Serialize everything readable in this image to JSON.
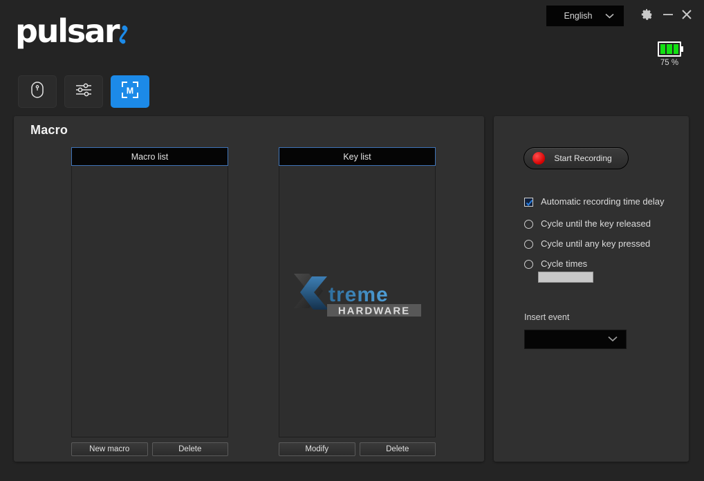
{
  "app": {
    "brand": "pulsar",
    "brand_mark_icon": "pulsar-comma-icon"
  },
  "header": {
    "language": {
      "value": "English",
      "chevron_icon": "chevron-down-icon"
    },
    "window_controls": {
      "settings_icon": "gear-icon",
      "minimize_icon": "minimize-icon",
      "close_icon": "close-icon"
    },
    "battery": {
      "label": "75 %",
      "bars": 3,
      "color": "#12e012",
      "icon": "battery-icon"
    }
  },
  "tabs": [
    {
      "name": "mouse",
      "icon": "mouse-icon",
      "active": false
    },
    {
      "name": "settings",
      "icon": "sliders-icon",
      "active": false
    },
    {
      "name": "macro",
      "icon": "macro-m-icon",
      "active": true
    }
  ],
  "main": {
    "title": "Macro",
    "macro_list": {
      "header": "Macro list",
      "items": [],
      "buttons": [
        {
          "label": "New macro"
        },
        {
          "label": "Delete"
        }
      ]
    },
    "key_list": {
      "header": "Key list",
      "items": [],
      "watermark": {
        "primary": "Xtreme",
        "secondary": "HARDWARE",
        "icon": "xtreme-hardware-watermark"
      },
      "buttons": [
        {
          "label": "Modify"
        },
        {
          "label": "Delete"
        }
      ]
    }
  },
  "sidebar": {
    "record_button": {
      "label": "Start Recording",
      "dot_color": "#d40000",
      "icon": "record-dot-icon"
    },
    "options": [
      {
        "type": "checkbox",
        "label": "Automatic recording time delay",
        "checked": true
      },
      {
        "type": "radio",
        "label": "Cycle until the key released",
        "checked": false
      },
      {
        "type": "radio",
        "label": "Cycle until any key pressed",
        "checked": false
      },
      {
        "type": "radio",
        "label": "Cycle times",
        "checked": false
      }
    ],
    "cycle_times_input": {
      "value": "",
      "placeholder": ""
    },
    "insert_event": {
      "label": "Insert event",
      "value": "",
      "chevron_icon": "chevron-down-icon"
    }
  },
  "theme": {
    "accent": "#1c8ae8",
    "panel_bg": "#303030",
    "window_bg": "#242424",
    "list_header_border": "#3f74b8"
  }
}
